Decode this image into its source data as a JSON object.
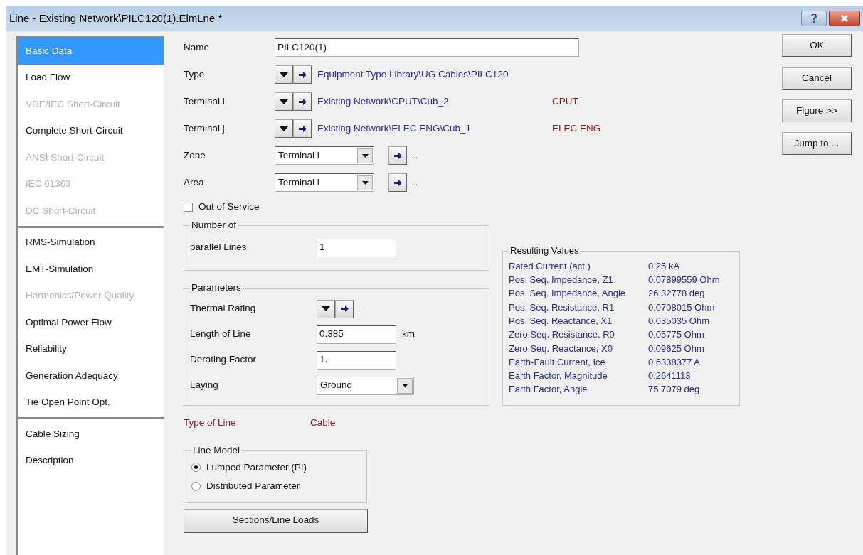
{
  "window": {
    "title": "Line - Existing Network\\PILC120(1).ElmLne *"
  },
  "sidebar": {
    "groups": [
      {
        "items": [
          {
            "label": "Basic Data",
            "selected": true,
            "disabled": false
          },
          {
            "label": "Load Flow",
            "selected": false,
            "disabled": false
          },
          {
            "label": "VDE/IEC Short-Circuit",
            "selected": false,
            "disabled": true
          },
          {
            "label": "Complete Short-Circuit",
            "selected": false,
            "disabled": false
          },
          {
            "label": "ANSI Short-Circuit",
            "selected": false,
            "disabled": true
          },
          {
            "label": "IEC 61363",
            "selected": false,
            "disabled": true
          },
          {
            "label": "DC Short-Circuit",
            "selected": false,
            "disabled": true
          }
        ]
      },
      {
        "items": [
          {
            "label": "RMS-Simulation",
            "selected": false,
            "disabled": false
          },
          {
            "label": "EMT-Simulation",
            "selected": false,
            "disabled": false
          },
          {
            "label": "Harmonics/Power Quality",
            "selected": false,
            "disabled": true
          },
          {
            "label": "Optimal Power Flow",
            "selected": false,
            "disabled": false
          },
          {
            "label": "Reliability",
            "selected": false,
            "disabled": false
          },
          {
            "label": "Generation Adequacy",
            "selected": false,
            "disabled": false
          },
          {
            "label": "Tie Open Point Opt.",
            "selected": false,
            "disabled": false
          }
        ]
      },
      {
        "items": [
          {
            "label": "Cable Sizing",
            "selected": false,
            "disabled": false
          },
          {
            "label": "Description",
            "selected": false,
            "disabled": false
          }
        ]
      }
    ]
  },
  "fields": [
    {
      "kind": "text",
      "label": "Name",
      "value": "PILC120(1)"
    },
    {
      "kind": "link",
      "label": "Type",
      "reference": "Equipment Type Library\\UG Cables\\PILC120"
    },
    {
      "kind": "link",
      "label": "Terminal i",
      "reference": "Existing Network\\CPUT\\Cub_2",
      "station": "CPUT"
    },
    {
      "kind": "link",
      "label": "Terminal j",
      "reference": "Existing Network\\ELEC ENG\\Cub_1",
      "station": "ELEC ENG"
    },
    {
      "kind": "select",
      "label": "Zone",
      "value": "Terminal i",
      "more": "..."
    },
    {
      "kind": "select",
      "label": "Area",
      "value": "Terminal i",
      "more": "..."
    }
  ],
  "out_of_service": {
    "label": "Out of Service",
    "checked": false
  },
  "number_of": {
    "title": "Number of",
    "label": "parallel Lines",
    "value": "1"
  },
  "parameters": {
    "title": "Parameters",
    "rows": [
      {
        "kind": "link",
        "label": "Thermal Rating",
        "more": "..."
      },
      {
        "kind": "input",
        "label": "Length of Line",
        "value": "0.385",
        "unit": "km"
      },
      {
        "kind": "input",
        "label": "Derating Factor",
        "value": "1."
      },
      {
        "kind": "select",
        "label": "Laying",
        "value": "Ground"
      }
    ]
  },
  "resulting_values": {
    "title": "Resulting Values",
    "rows": [
      {
        "label": "Rated Current (act.)",
        "value": "0.25 kA"
      },
      {
        "label": "Pos. Seq. Impedance, Z1",
        "value": "0.07899559 Ohm"
      },
      {
        "label": "Pos. Seq. Impedance, Angle",
        "value": "26.32778 deg"
      },
      {
        "label": "Pos. Seq. Resistance, R1",
        "value": "0.0708015 Ohm"
      },
      {
        "label": "Pos. Seq. Reactance, X1",
        "value": "0.035035 Ohm"
      },
      {
        "label": "Zero Seq. Resistance, R0",
        "value": "0.05775 Ohm"
      },
      {
        "label": "Zero Seq. Reactance, X0",
        "value": "0.09625 Ohm"
      },
      {
        "label": "Earth-Fault Current, Ice",
        "value": "0.6338377 A"
      },
      {
        "label": "Earth Factor, Magnitude",
        "value": "0.2641113"
      },
      {
        "label": "Earth Factor, Angle",
        "value": "75.7079 deg"
      }
    ]
  },
  "type_of_line": {
    "label": "Type of Line",
    "value": "Cable"
  },
  "line_model": {
    "title": "Line Model",
    "options": [
      {
        "label": "Lumped Parameter (PI)",
        "selected": true
      },
      {
        "label": "Distributed Parameter",
        "selected": false
      }
    ]
  },
  "sections_button": "Sections/Line Loads",
  "buttons": [
    "OK",
    "Cancel",
    "Figure >>",
    "Jump to ..."
  ]
}
